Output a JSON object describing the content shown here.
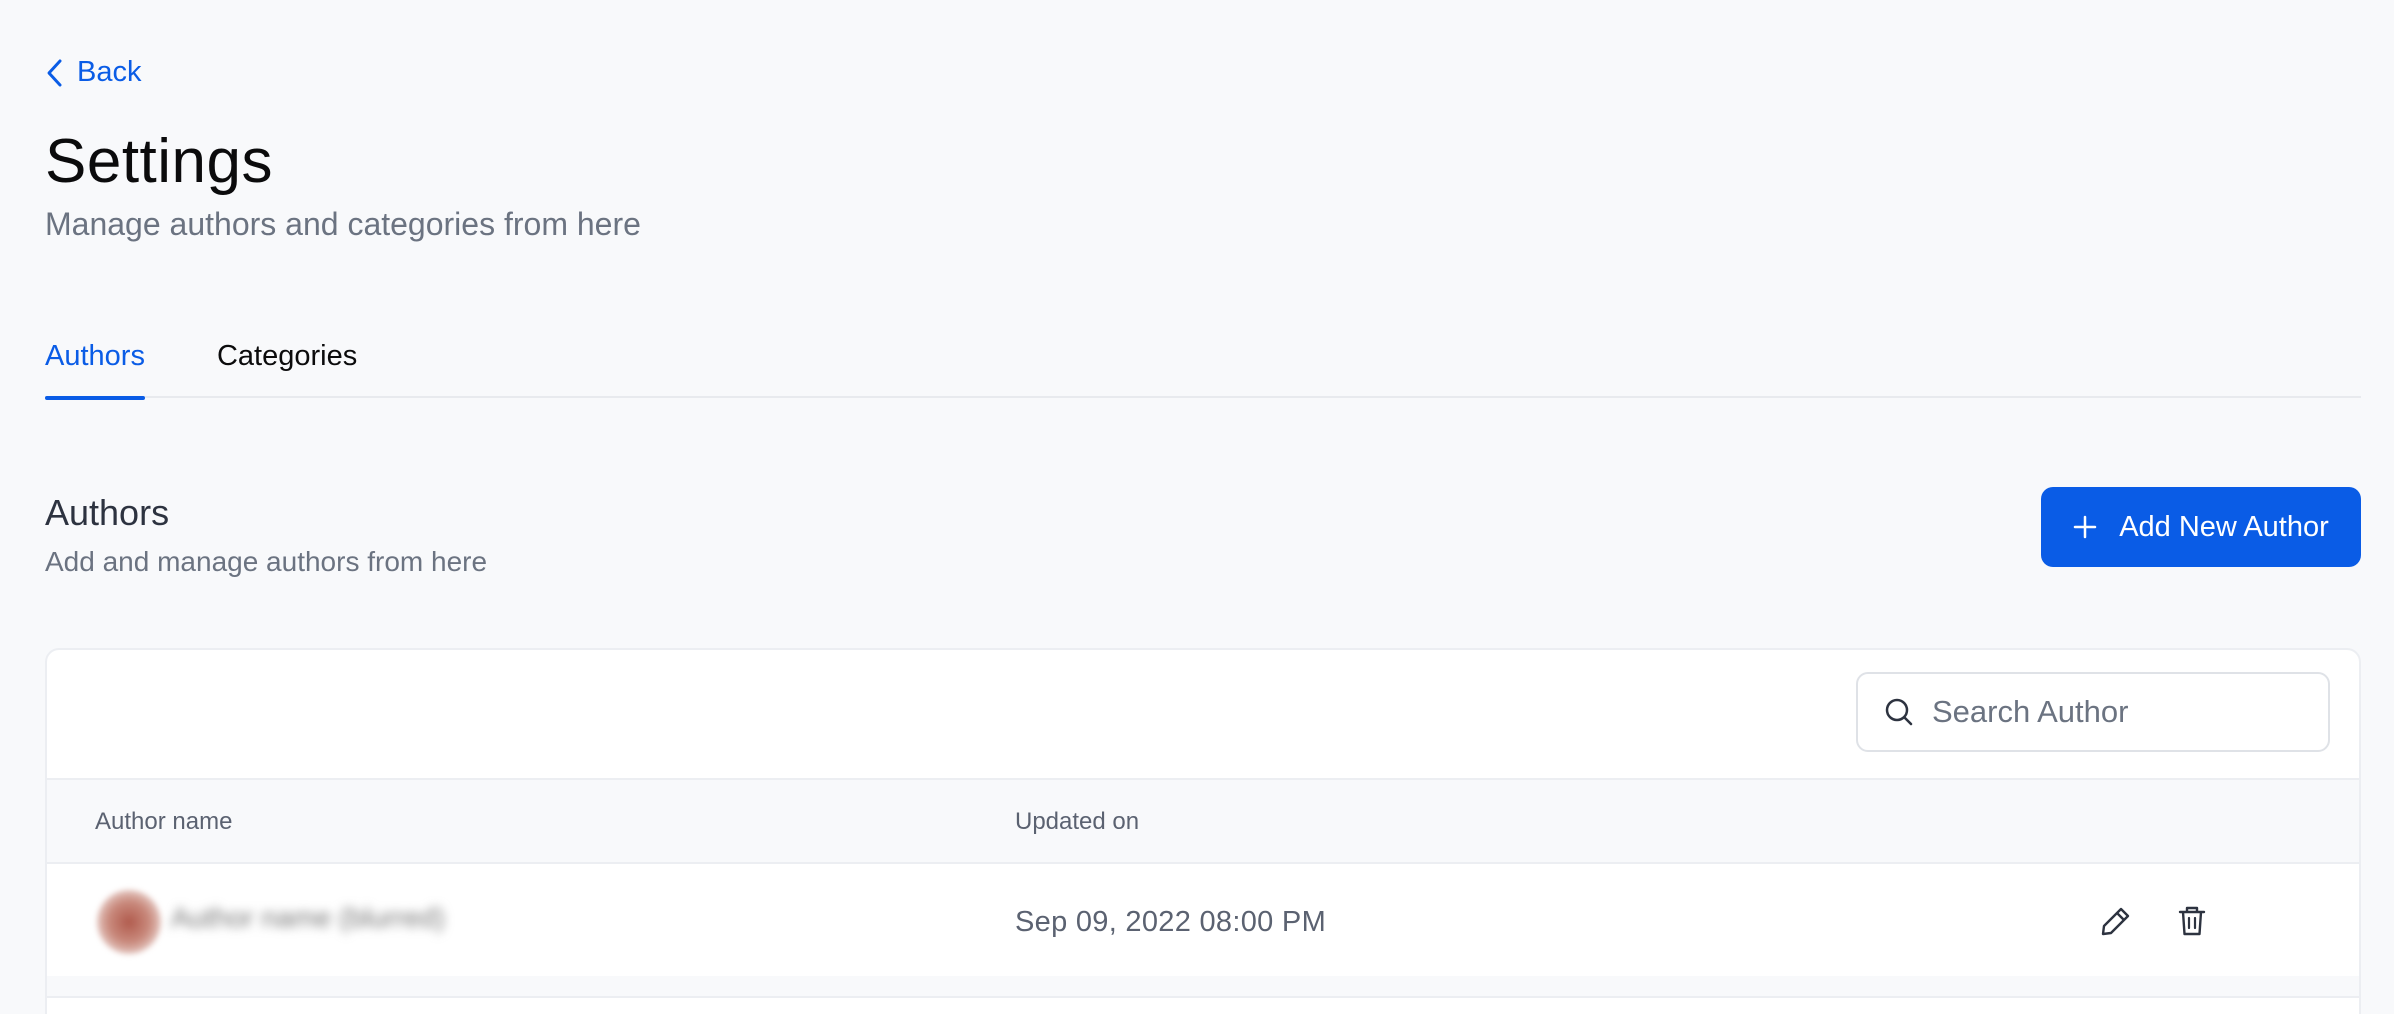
{
  "nav": {
    "back_label": "Back"
  },
  "header": {
    "title": "Settings",
    "subtitle": "Manage authors and categories from here"
  },
  "tabs": [
    {
      "label": "Authors",
      "active": true
    },
    {
      "label": "Categories",
      "active": false
    }
  ],
  "section": {
    "title": "Authors",
    "subtitle": "Add and manage authors from here",
    "add_button_label": "Add New Author"
  },
  "search": {
    "placeholder": "Search Author",
    "value": ""
  },
  "table": {
    "columns": [
      "Author name",
      "Updated on"
    ],
    "rows": [
      {
        "author_name": "Author name (blurred)",
        "updated_on": "Sep 09, 2022 08:00 PM"
      }
    ]
  },
  "colors": {
    "accent": "#0a5ce6",
    "background": "#f8f9fb",
    "card": "#ffffff",
    "muted_text": "#6b7381"
  },
  "icons": {
    "back": "chevron-left-icon",
    "add": "plus-icon",
    "search": "search-icon",
    "edit": "pencil-icon",
    "delete": "trash-icon"
  }
}
